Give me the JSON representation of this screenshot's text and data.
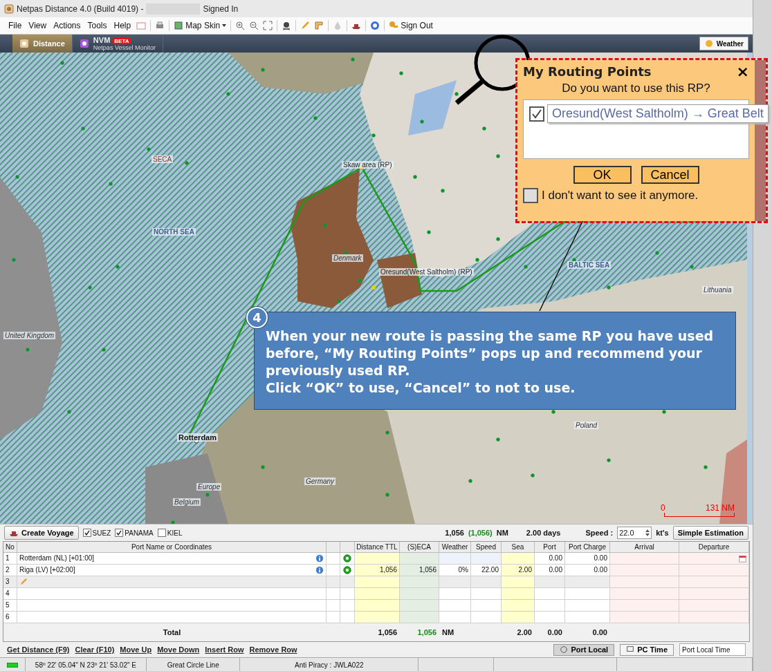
{
  "window": {
    "title": "Netpas Distance 4.0 (Build 4019) -",
    "status": "Signed In"
  },
  "menu": [
    "File",
    "View",
    "Actions",
    "Tools",
    "Help"
  ],
  "toolbar": {
    "map_skin": "Map Skin",
    "sign_out": "Sign Out"
  },
  "tabs": [
    {
      "label": "Distance",
      "selected": true
    },
    {
      "label": "NVM",
      "badge": "BETA",
      "subtitle": "Netpas Vessel Monitor",
      "selected": false
    }
  ],
  "weather_button": "Weather",
  "map": {
    "labels": [
      {
        "text": "SECA",
        "kind": "zone"
      },
      {
        "text": "NORTH SEA",
        "kind": "sea"
      },
      {
        "text": "Denmark",
        "kind": "country"
      },
      {
        "text": "Skaw area (RP)",
        "kind": "point"
      },
      {
        "text": "Oresund(West Saltholm) (RP)",
        "kind": "point"
      },
      {
        "text": "BALTIC SEA",
        "kind": "sea"
      },
      {
        "text": "Lithuania",
        "kind": "country"
      },
      {
        "text": "United Kingdom",
        "kind": "country"
      },
      {
        "text": "Rotterdam",
        "kind": "port"
      },
      {
        "text": "Europe",
        "kind": "country"
      },
      {
        "text": "Belgium",
        "kind": "country"
      },
      {
        "text": "Germany",
        "kind": "country"
      },
      {
        "text": "Poland",
        "kind": "country"
      }
    ],
    "scale": {
      "start": "0",
      "end": "131 NM"
    }
  },
  "callout": {
    "number": "4",
    "lines": [
      "When your new route is passing the same RP you have used before, “My Routing Points” pops up and recommend your previously used RP.",
      "Click “OK” to use, “Cancel” to not to use."
    ]
  },
  "dialog": {
    "title": "My Routing Points",
    "close": "×",
    "question": "Do you want to use this RP?",
    "items": [
      {
        "text": "Oresund(West Saltholm) → Great Belt",
        "checked": true
      }
    ],
    "buttons": [
      "OK",
      "Cancel"
    ],
    "dont_show": {
      "label": "I don't want to see it anymore.",
      "checked": false
    }
  },
  "voyage_bar": {
    "create": "Create Voyage",
    "canals": [
      {
        "label": "SUEZ",
        "checked": true
      },
      {
        "label": "PANAMA",
        "checked": true
      },
      {
        "label": "KIEL",
        "checked": false
      }
    ],
    "distance": "1,056",
    "eca_distance": "(1,056)",
    "unit": "NM",
    "days": "2.00 days",
    "speed_label": "Speed :",
    "speed": "22.0",
    "speed_unit": "kt's",
    "estimate": "Simple Estimation"
  },
  "table": {
    "columns": [
      {
        "label": "No"
      },
      {
        "label": "Port Name or Coordinates"
      },
      {
        "kind": "blank"
      },
      {
        "kind": "blank"
      },
      {
        "label": "Distance TTL"
      },
      {
        "label": "(S)ECA"
      },
      {
        "label": "Weather"
      },
      {
        "label": "Speed"
      },
      {
        "label": "Sea"
      },
      {
        "label": "Port"
      },
      {
        "label": "Port Charge"
      },
      {
        "label": "Arrival"
      },
      {
        "label": "Departure"
      }
    ],
    "rows": [
      {
        "no": "1",
        "port": "Rotterdam (NL) [+01:00]",
        "kind": "port",
        "port_days": "0.00",
        "port_charge": "0.00",
        "calendar": true,
        "selected": false
      },
      {
        "no": "2",
        "port": "Riga (LV) [+02:00]",
        "kind": "port",
        "distance": "1,056",
        "eca": "1,056",
        "weather": "0%",
        "speed": "22.00",
        "sea": "2.00",
        "port_days": "0.00",
        "port_charge": "0.00",
        "calendar": false,
        "selected": false
      },
      {
        "no": "3",
        "kind": "edit",
        "calendar": false,
        "selected": true
      },
      {
        "no": "4",
        "kind": "empty",
        "calendar": false,
        "selected": false
      },
      {
        "no": "5",
        "kind": "empty",
        "calendar": false,
        "selected": false
      },
      {
        "no": "6",
        "kind": "empty",
        "calendar": false,
        "selected": false
      }
    ],
    "total": {
      "label": "Total",
      "distance": "1,056",
      "eca": "1,056",
      "unit": "NM",
      "sea": "2.00",
      "port_days": "0.00",
      "port_charge": "0.00"
    }
  },
  "actions": [
    "Get Distance (F9)",
    "Clear (F10)",
    "Move Up",
    "Move Down",
    "Insert Row",
    "Remove Row"
  ],
  "time_buttons": [
    {
      "label": "Port Local",
      "selected": true
    },
    {
      "label": "PC Time",
      "selected": false
    }
  ],
  "time_field": "Port Local Time",
  "status_bar": {
    "coordinates": "58º 22' 05.04\" N 23º 21' 53.02\" E",
    "line": "Great Circle Line",
    "piracy": "Anti Piracy : JWLA022"
  }
}
